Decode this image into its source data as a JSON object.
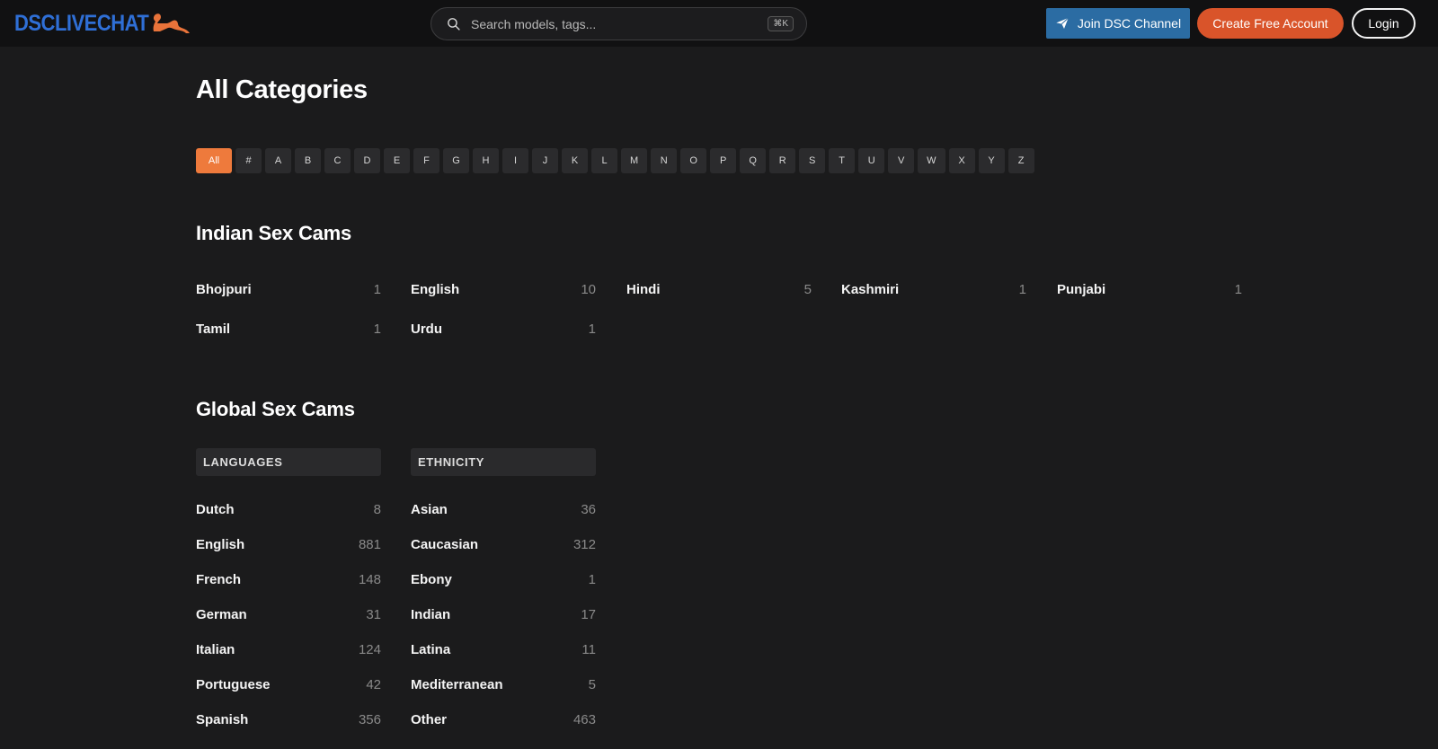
{
  "brand": {
    "logo_text": "DSCLIVECHAT",
    "logo_color": "#2f6fd6",
    "logo_figure_color": "#e8733a"
  },
  "search": {
    "placeholder": "Search models, tags...",
    "shortcut": "⌘K"
  },
  "header": {
    "join_channel": "Join DSC Channel",
    "create_account": "Create Free Account",
    "login": "Login"
  },
  "colors": {
    "accent": "#ee7a3c",
    "channel_blue": "#2b6ca3",
    "create_orange": "#d9542a"
  },
  "page_title": "All Categories",
  "alphabet": [
    "All",
    "#",
    "A",
    "B",
    "C",
    "D",
    "E",
    "F",
    "G",
    "H",
    "I",
    "J",
    "K",
    "L",
    "M",
    "N",
    "O",
    "P",
    "Q",
    "R",
    "S",
    "T",
    "U",
    "V",
    "W",
    "X",
    "Y",
    "Z"
  ],
  "active_letter": "All",
  "indian": {
    "title": "Indian Sex Cams",
    "items": [
      {
        "name": "Bhojpuri",
        "count": "1"
      },
      {
        "name": "English",
        "count": "10"
      },
      {
        "name": "Hindi",
        "count": "5"
      },
      {
        "name": "Kashmiri",
        "count": "1"
      },
      {
        "name": "Punjabi",
        "count": "1"
      },
      {
        "name": "Tamil",
        "count": "1"
      },
      {
        "name": "Urdu",
        "count": "1"
      }
    ]
  },
  "global": {
    "title": "Global Sex Cams",
    "languages": {
      "header": "LANGUAGES",
      "items": [
        {
          "name": "Dutch",
          "count": "8"
        },
        {
          "name": "English",
          "count": "881"
        },
        {
          "name": "French",
          "count": "148"
        },
        {
          "name": "German",
          "count": "31"
        },
        {
          "name": "Italian",
          "count": "124"
        },
        {
          "name": "Portuguese",
          "count": "42"
        },
        {
          "name": "Spanish",
          "count": "356"
        }
      ]
    },
    "ethnicity": {
      "header": "ETHNICITY",
      "items": [
        {
          "name": "Asian",
          "count": "36"
        },
        {
          "name": "Caucasian",
          "count": "312"
        },
        {
          "name": "Ebony",
          "count": "1"
        },
        {
          "name": "Indian",
          "count": "17"
        },
        {
          "name": "Latina",
          "count": "11"
        },
        {
          "name": "Mediterranean",
          "count": "5"
        },
        {
          "name": "Other",
          "count": "463"
        }
      ]
    }
  }
}
